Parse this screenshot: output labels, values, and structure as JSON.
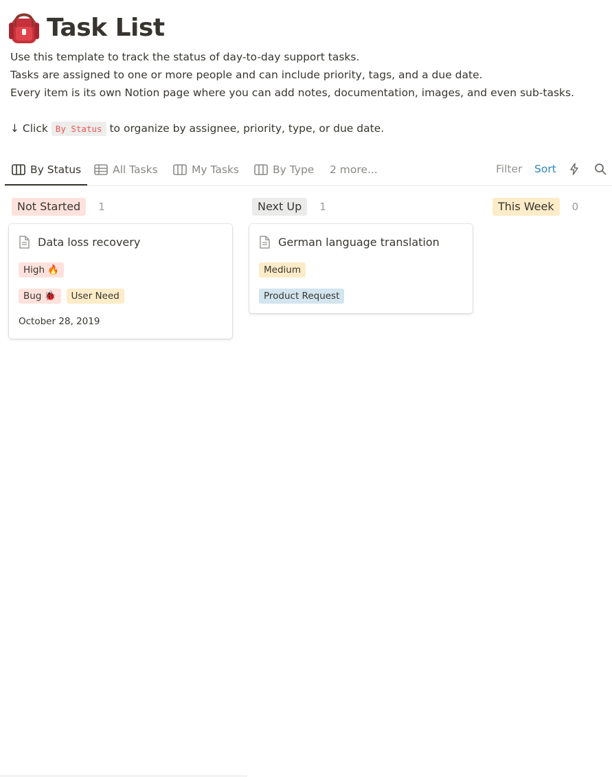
{
  "page": {
    "icon": "backpack-icon",
    "title": "Task List",
    "description": [
      "Use this template to track the status of day-to-day support tasks.",
      "Tasks are assigned to one or more people and can include priority, tags, and a due date.",
      "Every item is its own Notion page where you can add notes, documentation, images, and even sub-tasks."
    ],
    "hint": {
      "prefix": "↓ Click",
      "code": "By Status",
      "suffix": "to organize by assignee, priority, type, or due date."
    }
  },
  "views": {
    "tabs": [
      {
        "label": "By Status",
        "icon": "board-icon",
        "active": true
      },
      {
        "label": "All Tasks",
        "icon": "table-icon",
        "active": false
      },
      {
        "label": "My Tasks",
        "icon": "board-icon",
        "active": false
      },
      {
        "label": "By Type",
        "icon": "board-icon",
        "active": false
      }
    ],
    "more": "2 more...",
    "toolbar": {
      "filter": "Filter",
      "sort": "Sort",
      "automation_icon": "lightning-icon",
      "search_icon": "search-icon"
    }
  },
  "board": {
    "groups": [
      {
        "name": "Not Started",
        "count": "1",
        "color": "#ffe2dd",
        "cards": [
          {
            "title": "Data loss recovery",
            "priority": "High 🔥",
            "tags": [
              "Bug 🐞",
              "User Need"
            ],
            "date": "October 28, 2019"
          }
        ]
      },
      {
        "name": "Next Up",
        "count": "1",
        "color": "#e3e2e0",
        "cards": [
          {
            "title": "German language translation",
            "priority": "Medium",
            "tags": [
              "Product Request"
            ]
          }
        ]
      },
      {
        "name": "This Week",
        "count": "0",
        "color": "#fdecc8",
        "cards": []
      }
    ]
  },
  "colors": {
    "text": "#37352f",
    "accent": "#2e86c1",
    "code": "#eb5757"
  }
}
